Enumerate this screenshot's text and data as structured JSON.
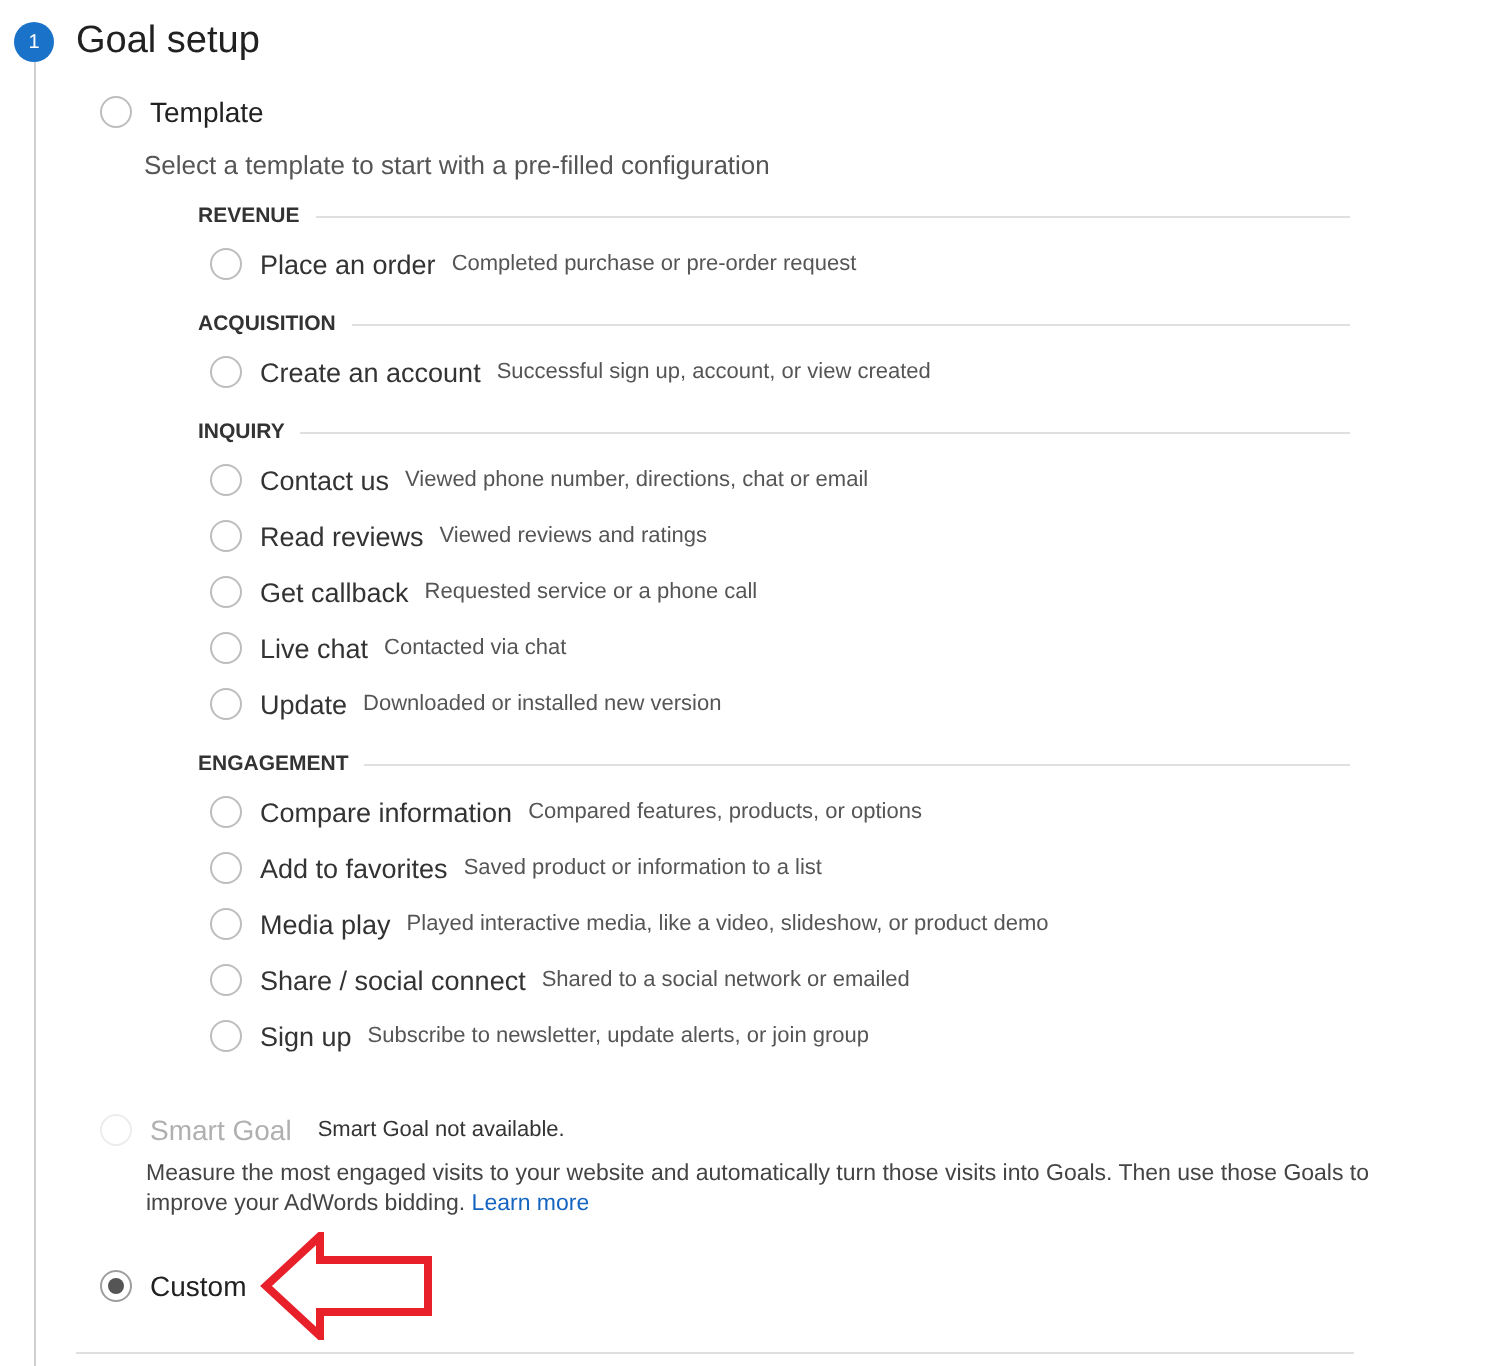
{
  "step": {
    "number": "1",
    "title": "Goal setup"
  },
  "options": [
    {
      "kind": "template",
      "label": "Template",
      "selected": false,
      "disabled": false,
      "description": "Select a template to start with a pre-filled configuration",
      "categories": [
        {
          "name": "REVENUE",
          "items": [
            {
              "label": "Place an order",
              "description": "Completed purchase or pre-order request",
              "selected": false
            }
          ]
        },
        {
          "name": "ACQUISITION",
          "items": [
            {
              "label": "Create an account",
              "description": "Successful sign up, account, or view created",
              "selected": false
            }
          ]
        },
        {
          "name": "INQUIRY",
          "items": [
            {
              "label": "Contact us",
              "description": "Viewed phone number, directions, chat or email",
              "selected": false
            },
            {
              "label": "Read reviews",
              "description": "Viewed reviews and ratings",
              "selected": false
            },
            {
              "label": "Get callback",
              "description": "Requested service or a phone call",
              "selected": false
            },
            {
              "label": "Live chat",
              "description": "Contacted via chat",
              "selected": false
            },
            {
              "label": "Update",
              "description": "Downloaded or installed new version",
              "selected": false
            }
          ]
        },
        {
          "name": "ENGAGEMENT",
          "items": [
            {
              "label": "Compare information",
              "description": "Compared features, products, or options",
              "selected": false
            },
            {
              "label": "Add to favorites",
              "description": "Saved product or information to a list",
              "selected": false
            },
            {
              "label": "Media play",
              "description": "Played interactive media, like a video, slideshow, or product demo",
              "selected": false
            },
            {
              "label": "Share / social connect",
              "description": "Shared to a social network or emailed",
              "selected": false
            },
            {
              "label": "Sign up",
              "description": "Subscribe to newsletter, update alerts, or join group",
              "selected": false
            }
          ]
        }
      ]
    },
    {
      "kind": "smart",
      "label": "Smart Goal",
      "selected": false,
      "disabled": true,
      "note": "Smart Goal not available.",
      "description": "Measure the most engaged visits to your website and automatically turn those visits into Goals. Then use those Goals to improve your AdWords bidding.",
      "link": "Learn more"
    },
    {
      "kind": "custom",
      "label": "Custom",
      "selected": true,
      "disabled": false
    }
  ]
}
